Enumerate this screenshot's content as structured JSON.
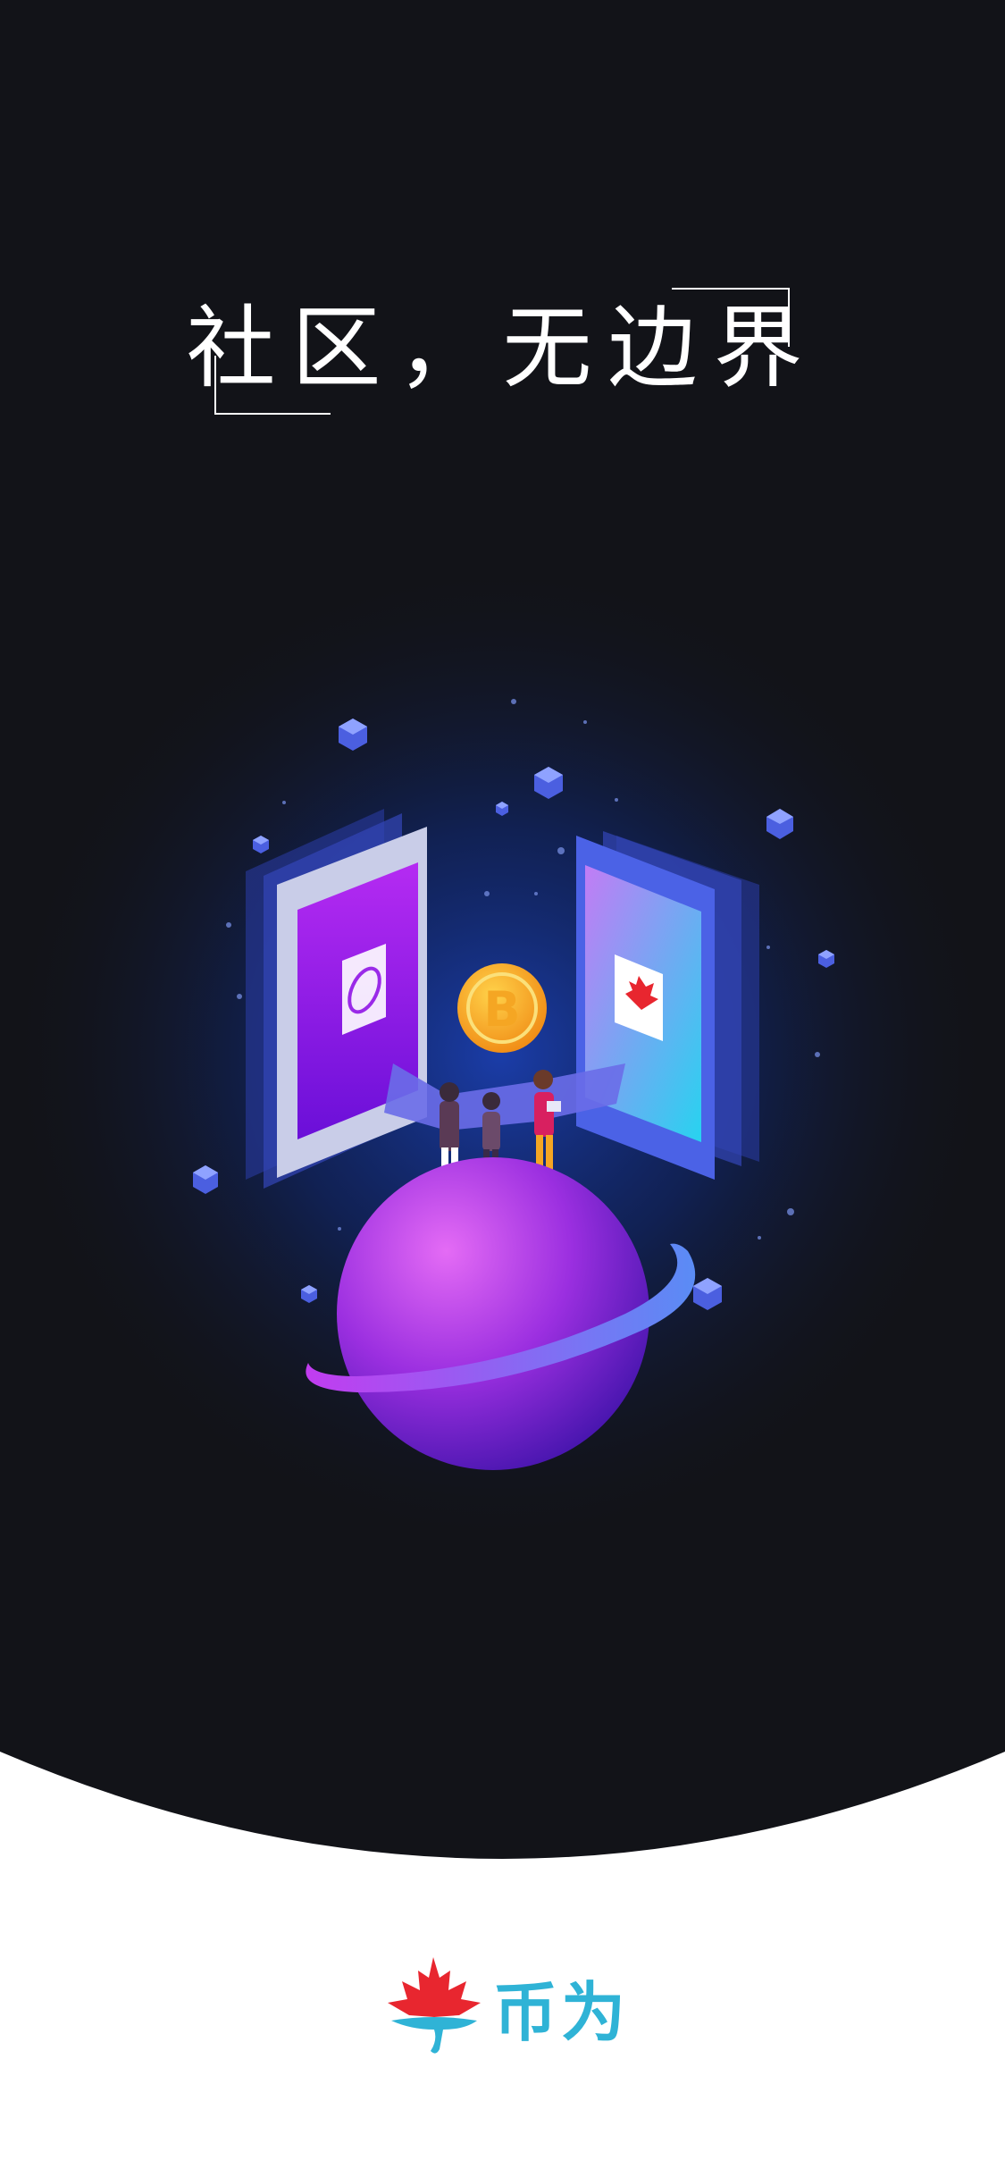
{
  "splash": {
    "headline": "社区，无边界",
    "brand_name": "币为",
    "logo_icon": "maple-leaf-icon",
    "coin_icon": "coin-icon",
    "coin_letter": "B",
    "colors": {
      "background_dark": "#121318",
      "background_light": "#ffffff",
      "brand_teal": "#2fb3d6",
      "brand_red": "#e8262f",
      "planet_purple": "#9b2fe0",
      "coin_orange": "#f6a21c"
    }
  }
}
